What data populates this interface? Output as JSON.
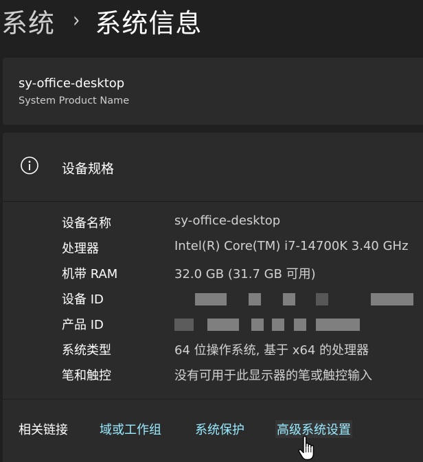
{
  "breadcrumb": {
    "parent": "系统",
    "separator": "›",
    "current": "系统信息"
  },
  "device": {
    "name": "sy-office-desktop",
    "model": "System Product Name"
  },
  "specs": {
    "title": "设备规格",
    "icon": "info-icon",
    "rows": [
      {
        "label": "设备名称",
        "value": "sy-office-desktop"
      },
      {
        "label": "处理器",
        "value": "Intel(R) Core(TM) i7-14700K   3.40 GHz"
      },
      {
        "label": "机带 RAM",
        "value": "32.0 GB (31.7 GB 可用)"
      },
      {
        "label": "设备 ID",
        "value": ""
      },
      {
        "label": "产品 ID",
        "value": ""
      },
      {
        "label": "系统类型",
        "value": "64 位操作系统, 基于 x64 的处理器"
      },
      {
        "label": "笔和触控",
        "value": "没有可用于此显示器的笔或触控输入"
      }
    ]
  },
  "related_links": {
    "title": "相关链接",
    "items": [
      {
        "label": "域或工作组"
      },
      {
        "label": "系统保护"
      },
      {
        "label": "高级系统设置"
      }
    ]
  },
  "colors": {
    "background": "#202020",
    "card": "#2b2b2b",
    "link": "#99ebff"
  }
}
